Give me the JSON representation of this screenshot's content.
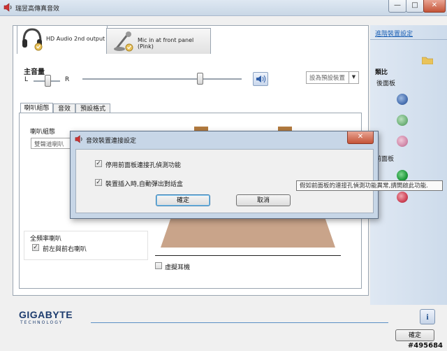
{
  "window": {
    "title": "瑞昱高傳真音效",
    "caption_buttons": {
      "minimize": "—",
      "maximize": "□",
      "close": "✕"
    }
  },
  "devices": {
    "tabs": [
      {
        "label": "HD Audio 2nd output",
        "icon": "headphones-icon",
        "active": true
      },
      {
        "label": "Mic in at front panel (Pink)",
        "icon": "microphone-icon",
        "active": false
      }
    ]
  },
  "volume": {
    "title": "主音量",
    "left_label": "L",
    "right_label": "R",
    "balance_level": 0.5,
    "master_level": 0.7,
    "default_device_label": "設為預設裝置",
    "speaker_icon": "speaker-icon"
  },
  "subtabs": [
    "喇叭組態",
    "音效",
    "預設格式"
  ],
  "speaker_config": {
    "label": "喇叭組態",
    "value": "雙聲道喇叭",
    "fullrange_label": "全頻率喇叭",
    "fullrange_check": "前左與前右喇叭",
    "virtual_surround": "虛擬耳機"
  },
  "right_pane": {
    "link": "進階裝置設定",
    "analog_label": "類比",
    "rear_panel": "後面板",
    "front_panel": "前面板",
    "folder_icon": "folder-icon",
    "jack_colors": [
      "#5f89c9",
      "#7fbf87",
      "#d991b1",
      "#2aa34a",
      "#d34b5d"
    ]
  },
  "dialog": {
    "title": "音效裝置連接設定",
    "option1": "停用前面板連接孔偵測功能",
    "option2": "裝置插入時,自動彈出對話盒",
    "ok": "確定",
    "cancel": "取消",
    "close": "✕"
  },
  "tooltip": "假如前面板的連接孔偵測功能異常,請開啟此功能.",
  "footer": {
    "brand": "GIGABYTE",
    "brand_sub": "TECHNOLOGY",
    "info": "i",
    "ok": "確定"
  },
  "watermark": "#495684"
}
